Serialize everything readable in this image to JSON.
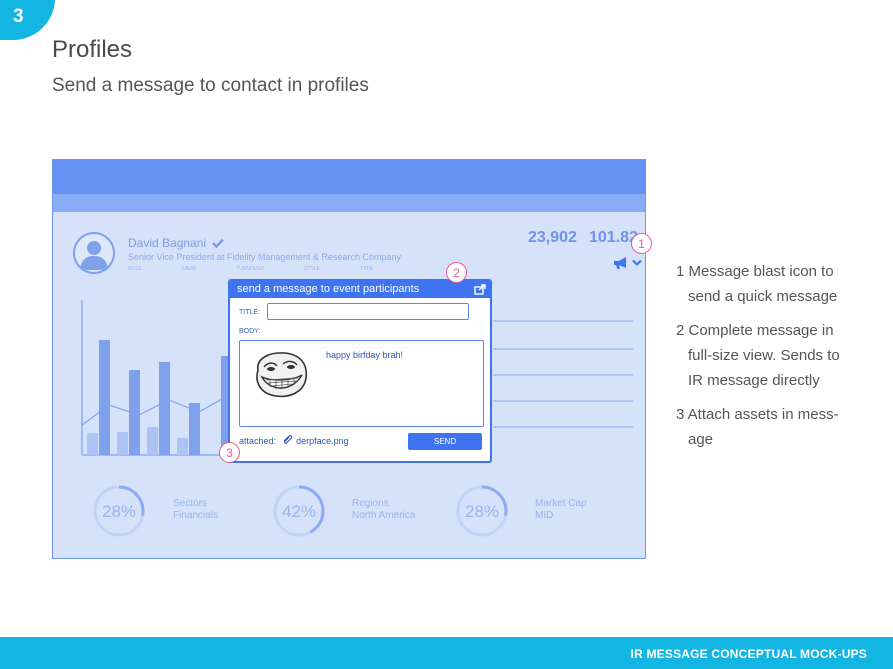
{
  "slide": {
    "number": "3",
    "title": "Profiles",
    "subtitle": "Send a message to contact in profiles",
    "footer": "IR MESSAGE CONCEPTUAL MOCK-UPS"
  },
  "profile": {
    "name": "David Bagnani",
    "job_title": "Senior Vice President at Fidelity Management & Research Company",
    "tabs": [
      "ROLE",
      "EAUM",
      "TURNOVER",
      "STYLE",
      "TYPE"
    ],
    "stat1": "23,902",
    "stat2": "101.82",
    "cards": [
      {
        "pct": "28%",
        "value": 0.28,
        "line1": "Sectors",
        "line2": "Financials"
      },
      {
        "pct": "42%",
        "value": 0.42,
        "line1": "Regions",
        "line2": "North America"
      },
      {
        "pct": "28%",
        "value": 0.28,
        "line1": "Market Cap",
        "line2": "MID"
      }
    ]
  },
  "dialog": {
    "header": "send a message to event participants",
    "title_label": "TITLE:",
    "title_value": "",
    "body_label": "BODY:",
    "message": "happy birfday brah!",
    "attached_label": "attached:",
    "attached_file": "derpface.png",
    "send_label": "SEND"
  },
  "markers": [
    "1",
    "2",
    "3"
  ],
  "notes": [
    {
      "line1": "1 Message blast icon to",
      "line2": "send a quick message"
    },
    {
      "line1": "2 Complete message in",
      "line2": "full-size view. Sends to",
      "line3": "IR message directly"
    },
    {
      "line1": "3 Attach assets in mess-",
      "line2": "age"
    }
  ],
  "colors": {
    "accent": "#13b5e3",
    "mock_blue": "#3f74f0",
    "marker": "#e45a94"
  }
}
